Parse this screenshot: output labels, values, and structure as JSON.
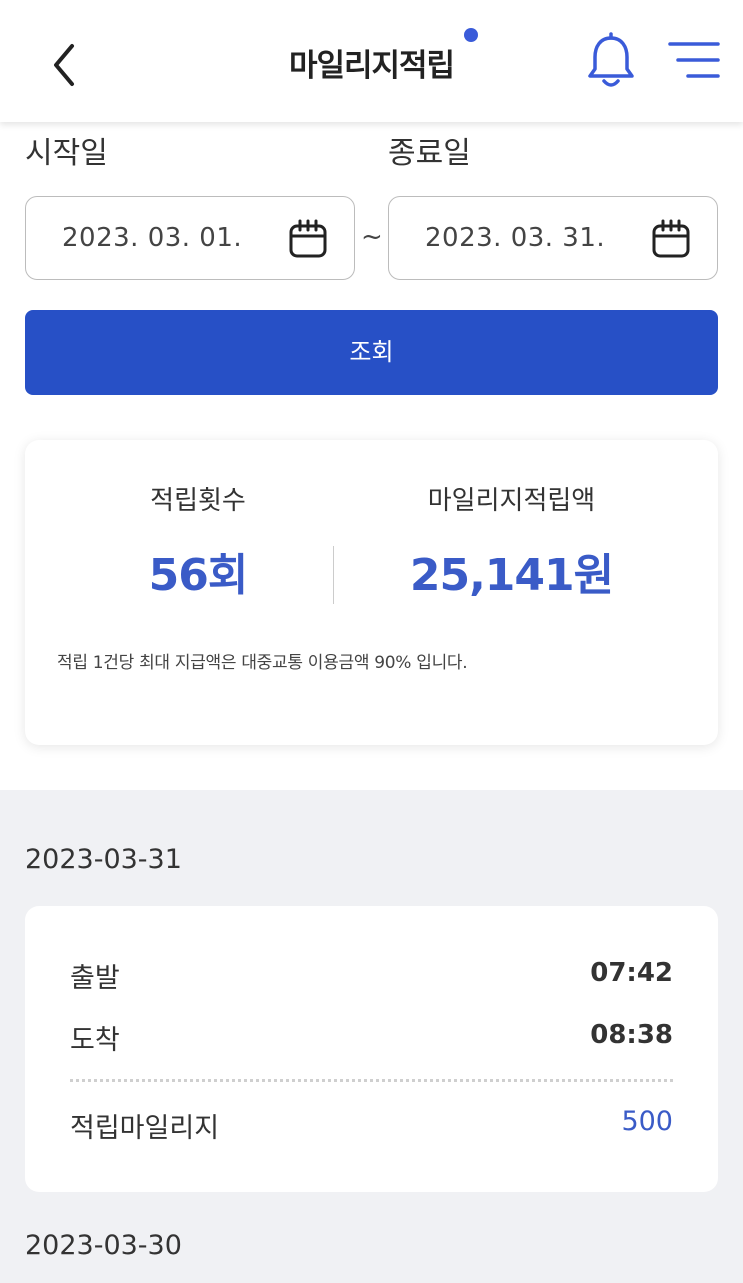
{
  "header": {
    "title": "마일리지적립",
    "back_icon": "chevron-left-icon",
    "notify_icon": "bell-icon",
    "menu_icon": "menu-icon",
    "accent_color": "#3a5bd9"
  },
  "search": {
    "start_label": "시작일",
    "end_label": "종료일",
    "start_date": "2023. 03. 01.",
    "end_date": "2023. 03. 31.",
    "separator": "~",
    "button_label": "조회",
    "button_color": "#2750c6"
  },
  "summary": {
    "count_label": "적립횟수",
    "count_value": "56회",
    "amount_label": "마일리지적립액",
    "amount_value": "25,141원",
    "note": "적립 1건당 최대 지급액은 대중교통 이용금액 90% 입니다."
  },
  "history": [
    {
      "date": "2023-03-31",
      "departure_label": "출발",
      "departure_time": "07:42",
      "arrival_label": "도착",
      "arrival_time": "08:38",
      "mileage_label": "적립마일리지",
      "mileage_value": "500"
    },
    {
      "date": "2023-03-30"
    }
  ]
}
